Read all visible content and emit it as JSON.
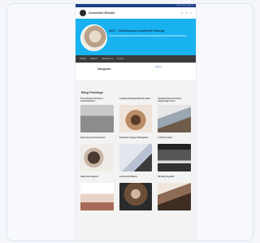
{
  "topbar": {
    "text": "Subscribe | Sign in"
  },
  "header": {
    "brand": "Convention Wisdom",
    "icons": [
      "search-icon",
      "menu-icon",
      "close-icon"
    ]
  },
  "hero": {
    "title": "SALT - Self-Advocacy Leadership Training"
  },
  "nav": {
    "items": [
      "HOME",
      "ABOUT",
      "PROJECTS",
      "BLOG"
    ]
  },
  "tabs": {
    "categories": "Categories",
    "about": "About"
  },
  "blog": {
    "title": "Blog Postings",
    "posts": [
      {
        "title": "Trust, Respect & Perfect Communication"
      },
      {
        "title": "Cognitive Hacking Effective Gains"
      },
      {
        "title": "Empathy Based Practices Supporting Access"
      },
      {
        "title": "Improving Communication"
      },
      {
        "title": "Boundaries Support Navigation"
      },
      {
        "title": "A Path Forward"
      },
      {
        "title": "Safety and Support"
      },
      {
        "title": "Community Matters"
      },
      {
        "title": "Working Together"
      }
    ]
  }
}
